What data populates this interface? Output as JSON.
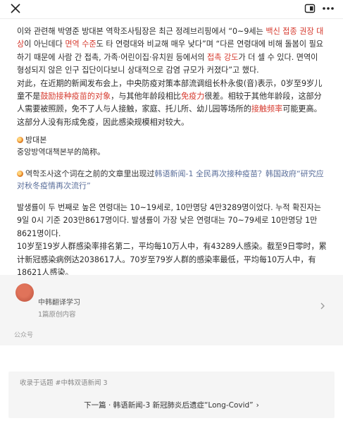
{
  "article": {
    "p1": [
      {
        "t": "이와 관련해 박영준 방대본 역학조사팀장은 최근 정례브리핑에서 “0~9세는 "
      },
      {
        "t": "백신 접종 권장 대상",
        "red": true
      },
      {
        "t": "이 아닌데다 "
      },
      {
        "t": "면역 수준",
        "red": true
      },
      {
        "t": "도 타 연령대와 비교해 매우 낮다”며 “다른 연령대에 비해 돌봄이 필요하기 때문에 사람 간 접촉, 가족·어린이집·유치원 등에서의 "
      },
      {
        "t": "접촉 강도",
        "red": true
      },
      {
        "t": "가 더 셀 수 있다. 면역이 형성되지 않은 인구 집단이다보니 상대적으로 감염 규모가 커졌다”고 했다."
      }
    ],
    "p2": [
      {
        "t": "对此，在近期的新闻发布会上，中央防疫对策本部流调组长朴永俊(音)表示，0岁至9岁儿童不是"
      },
      {
        "t": "鼓励接种疫苗的对象",
        "red": true
      },
      {
        "t": "，与其他年龄段相比"
      },
      {
        "t": "免疫力",
        "red": true
      },
      {
        "t": "很差。相较于其他年龄段，这部分人需要被照顾，免不了人与人接触，家庭、托儿所、幼儿园等场所的"
      },
      {
        "t": "接触频率",
        "red": true
      },
      {
        "t": "可能更高。这部分人没有形成免疫，因此感染规模相对较大。"
      }
    ],
    "p3": [
      {
        "t": "발생률이 두 번째로 높은 연령대는 10~19세로, 10만명당 4만3289명이었다. 누적 확진자는 9일 0시 기준 203만8617명이다. 발생률이 가장 낮은 연령대는 70~79세로 10만명당 1만8621명이다."
      }
    ],
    "p4": [
      {
        "t": "10岁至19岁人群感染率排名第二，平均每10万人中，有43289人感染。截至9日零时，累计新冠感染病例达2038617人。70岁至79岁人群的感染率最低，平均每10万人中，有18621人感染。"
      }
    ]
  },
  "notes": {
    "n1_term": "방대본",
    "n1_def": "중앙방역대책본부的简称。",
    "n2_term": "역학조사",
    "n2_text": "这个词在之前的文章里出现过",
    "n2_link": "韩语新闻-1 全民再次接种疫苗？韩国政府“研究应对秋冬疫情再次流行”"
  },
  "account": {
    "name": "中韩翻译学习",
    "sub": "1篇原创内容",
    "label": "公众号"
  },
  "collection": {
    "topic": "收录于话题 #中韩双语新闻 3",
    "next": "下一篇 · 韩语新闻-3 新冠肺炎后遗症“Long-Covid”",
    "arrow": "›"
  },
  "icons": {
    "close": "close-icon",
    "window": "window-toggle-icon",
    "more": "more-icon"
  },
  "colors": {
    "highlight": "#d63b2f",
    "link": "#5a6e9a"
  }
}
